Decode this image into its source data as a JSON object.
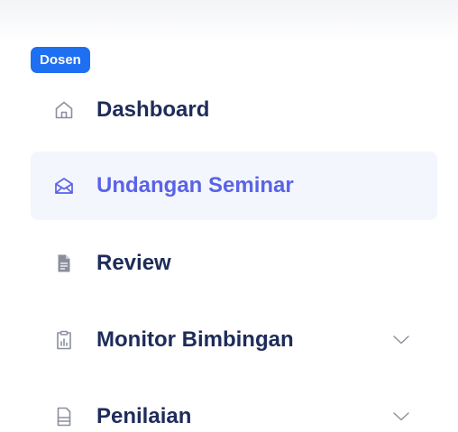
{
  "sidebar": {
    "section_badge": "Dosen",
    "items": [
      {
        "label": "Dashboard",
        "icon": "home-icon",
        "active": false,
        "expandable": false
      },
      {
        "label": "Undangan Seminar",
        "icon": "envelope-icon",
        "active": true,
        "expandable": false
      },
      {
        "label": "Review",
        "icon": "document-icon",
        "active": false,
        "expandable": false
      },
      {
        "label": "Monitor Bimbingan",
        "icon": "clipboard-chart-icon",
        "active": false,
        "expandable": true
      },
      {
        "label": "Penilaian",
        "icon": "file-lines-icon",
        "active": false,
        "expandable": true
      }
    ],
    "colors": {
      "badge_bg": "#1e6ff1",
      "active_bg": "#f4f6fd",
      "active_text": "#5a63e6",
      "text": "#1e2c5a",
      "icon": "#8a8f9c"
    }
  }
}
